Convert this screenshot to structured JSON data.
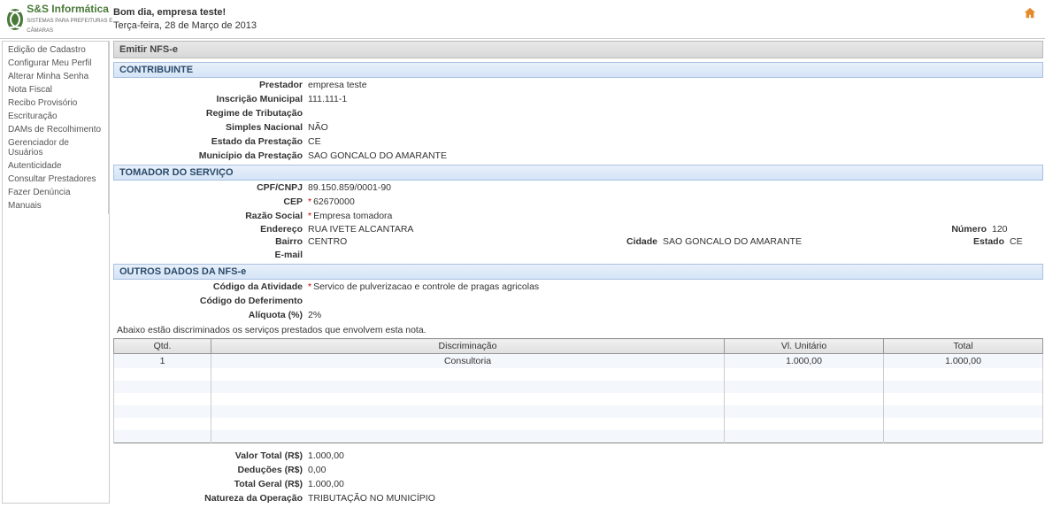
{
  "header": {
    "brand_name": "S&S Informática",
    "brand_tagline": "SISTEMAS PARA PREFEITURAS E CÂMARAS",
    "greeting": "Bom dia, empresa teste!",
    "date": "Terça-feira, 28 de Março de 2013"
  },
  "sidebar": {
    "items": [
      "Edição de Cadastro",
      "Configurar Meu Perfil",
      "Alterar Minha Senha",
      "Nota Fiscal",
      "Recibo Provisório",
      "Escrituração",
      "DAMs de Recolhimento",
      "Gerenciador de Usuários",
      "Autenticidade",
      "Consultar Prestadores",
      "Fazer Denúncia",
      "Manuais"
    ]
  },
  "page": {
    "title": "Emitir NFS-e"
  },
  "sections": {
    "contribuinte": {
      "title": "CONTRIBUINTE",
      "labels": {
        "prestador": "Prestador",
        "inscricao": "Inscrição Municipal",
        "regime": "Regime de Tributação",
        "simples": "Simples Nacional",
        "estado_prest": "Estado da Prestação",
        "municipio_prest": "Município da Prestação"
      },
      "values": {
        "prestador": "empresa teste",
        "inscricao": "111.111-1",
        "regime": "",
        "simples": "NÃO",
        "estado_prest": "CE",
        "municipio_prest": "SAO GONCALO DO AMARANTE"
      }
    },
    "tomador": {
      "title": "TOMADOR DO SERVIÇO",
      "labels": {
        "cpf": "CPF/CNPJ",
        "cep": "CEP",
        "razao": "Razão Social",
        "endereco": "Endereço",
        "bairro": "Bairro",
        "email": "E-mail",
        "numero": "Número",
        "cidade": "Cidade",
        "estado": "Estado"
      },
      "values": {
        "cpf": "89.150.859/0001-90",
        "cep": "62670000",
        "razao": "Empresa tomadora",
        "endereco": "RUA IVETE ALCANTARA",
        "bairro": "CENTRO",
        "email": "",
        "numero": "120",
        "cidade": "SAO GONCALO DO AMARANTE",
        "estado": "CE"
      }
    },
    "outros": {
      "title": "OUTROS DADOS DA NFS-e",
      "labels": {
        "codigo_atividade": "Código da Atividade",
        "codigo_deferimento": "Código do Deferimento",
        "aliquota": "Alíquota (%)"
      },
      "values": {
        "codigo_atividade": "Servico de pulverizacao e controle de pragas agricolas",
        "codigo_deferimento": "",
        "aliquota": "2%"
      }
    }
  },
  "discrim": {
    "note": "Abaixo estão discriminados os serviços prestados que envolvem esta nota.",
    "headers": {
      "qtd": "Qtd.",
      "disc": "Discriminação",
      "unit": "Vl. Unitário",
      "total": "Total"
    },
    "rows": [
      {
        "qtd": "1",
        "disc": "Consultoria",
        "unit": "1.000,00",
        "total": "1.000,00"
      }
    ]
  },
  "totals": {
    "labels": {
      "valor_total": "Valor Total (R$)",
      "deducoes": "Deduções (R$)",
      "total_geral": "Total Geral (R$)",
      "natureza": "Natureza da Operação"
    },
    "values": {
      "valor_total": "1.000,00",
      "deducoes": "0,00",
      "total_geral": "1.000,00",
      "natureza": "TRIBUTAÇÃO NO MUNICÍPIO"
    }
  }
}
